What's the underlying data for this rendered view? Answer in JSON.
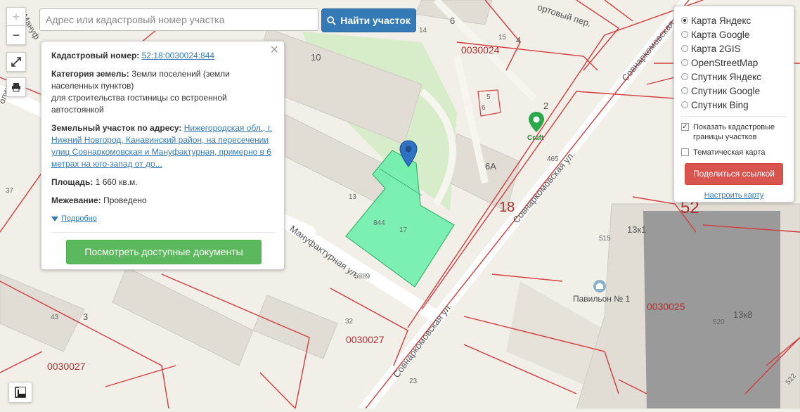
{
  "controls": {
    "zoom_in": "+",
    "zoom_out": "−"
  },
  "search": {
    "placeholder": "Адрес или кадастровый номер участка",
    "button_label": "Найти участок"
  },
  "info_panel": {
    "cadastral_label": "Кадастровый номер:",
    "cadastral_value": "52:18:0030024:844",
    "category_label": "Категория земель:",
    "category_value": "Земли поселений (земли населенных пунктов)",
    "purpose": "для строительства гостиницы со встроенной автостоянкой",
    "address_label": "Земельный участок по адресу:",
    "address_value": "Нижегородская обл., г. Нижний Новгород, Канавинский район, на пересечении улиц Совнаркомовская и Мануфактурная, примерно в 6 метрах на юго-запад от до...",
    "area_label": "Площадь:",
    "area_value": "1 660 кв.м.",
    "survey_label": "Межевание:",
    "survey_value": "Проведено",
    "more_link": "Подробно",
    "docs_button": "Посмотреть доступные документы"
  },
  "layers": {
    "options": [
      {
        "label": "Карта Яндекс",
        "selected": true
      },
      {
        "label": "Карта Google",
        "selected": false
      },
      {
        "label": "Карта 2GIS",
        "selected": false
      },
      {
        "label": "OpenStreetMap",
        "selected": false
      },
      {
        "label": "Спутник Яндекс",
        "selected": false
      },
      {
        "label": "Спутник Google",
        "selected": false
      },
      {
        "label": "Спутник Bing",
        "selected": false
      }
    ],
    "show_borders_label": "Показать кадастровые границы участков",
    "show_borders_checked": true,
    "thematic_label": "Тематическая карта",
    "thematic_checked": false,
    "share_button": "Поделиться ссылкой",
    "configure_link": "Настроить карту"
  },
  "map": {
    "labels": {
      "b6": "6",
      "b14": "14",
      "b4": "4",
      "b15": "15",
      "q0030024": "0030024",
      "b10": "10",
      "b5": "5",
      "b6s": "6",
      "b2": "2",
      "craft": "Craft",
      "b465": "465",
      "b6a": "6А",
      "b13": "13",
      "b844": "844",
      "b17": "17",
      "b18": "18",
      "b52": "52",
      "b13k1": "13к1",
      "b515": "515",
      "b37": "37",
      "b5889": "5889",
      "pavilion": "Павильон № 1",
      "q0030025": "0030025",
      "b13k8": "13к8",
      "b520": "520",
      "b43": "43",
      "b3": "3",
      "b32": "32",
      "q0030027a": "0030027",
      "q0030027b": "0030027",
      "b23": "23",
      "b522": "522"
    },
    "streets": {
      "manufakturnaya": "Мануфактурная ул.",
      "sovnarkom_upper": "Совнаркомовская",
      "sovnarkom_mid": "Совнаркомовская ул.",
      "sovnarkom_lower": "Совнаркомовская ул.",
      "portovy": "ортовый пер.",
      "left_top": "Мануф",
      "left_mid": "олиц"
    },
    "colors": {
      "parcel_fill": "#66f0a8",
      "parcel_border": "#3cb371",
      "cadastral_line": "#d23c3c",
      "marker_blue": "#2f72c4",
      "marker_green": "#2aa84a"
    }
  }
}
